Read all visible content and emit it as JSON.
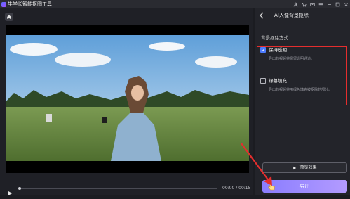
{
  "app": {
    "title": "牛学长智能抠图工具"
  },
  "titlebar": {
    "icons": [
      "user-icon",
      "cart-icon",
      "message-icon",
      "menu-icon",
      "minimize-icon",
      "maximize-icon",
      "close-icon"
    ]
  },
  "player": {
    "time": "00:00 / 00:15",
    "progress": 0.0
  },
  "panel": {
    "title": "AI人像背景抠除",
    "section_label": "背景抠除方式",
    "options": [
      {
        "title": "保持透明",
        "desc": "导出的视频将保留透明通道。",
        "checked": true
      },
      {
        "title": "绿幕填充",
        "desc": "导出的视频将用绿色填充被抠除的部分。",
        "checked": false
      }
    ],
    "preview_label": "预览效果",
    "export_label": "导出"
  },
  "colors": {
    "accent": "#4d7cff",
    "highlight": "#e52e2e",
    "export_start": "#8a7dff",
    "export_end": "#b39bff"
  }
}
